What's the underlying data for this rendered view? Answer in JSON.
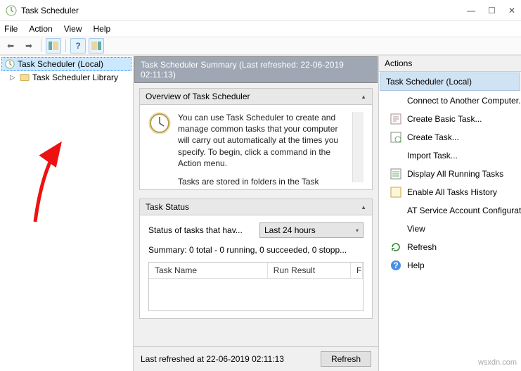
{
  "window": {
    "title": "Task Scheduler",
    "controls": {
      "min": "—",
      "max": "☐",
      "close": "✕"
    }
  },
  "menu": {
    "file": "File",
    "action": "Action",
    "view": "View",
    "help": "Help"
  },
  "tree": {
    "root": "Task Scheduler (Local)",
    "child": "Task Scheduler Library"
  },
  "summary": {
    "header": "Task Scheduler Summary (Last refreshed: 22-06-2019 02:11:13)",
    "overview_title": "Overview of Task Scheduler",
    "overview_text1": "You can use Task Scheduler to create and manage common tasks that your computer will carry out automatically at the times you specify. To begin, click a command in the Action menu.",
    "overview_text2": "Tasks are stored in folders in the Task",
    "status_title": "Task Status",
    "status_label": "Status of tasks that hav...",
    "status_period": "Last 24 hours",
    "status_summary": "Summary: 0 total - 0 running, 0 succeeded, 0 stopp...",
    "cols": {
      "name": "Task Name",
      "result": "Run Result",
      "r3": "F"
    },
    "footer_text": "Last refreshed at 22-06-2019 02:11:13",
    "refresh_btn": "Refresh"
  },
  "actions": {
    "title": "Actions",
    "header": "Task Scheduler (Local)",
    "items": [
      "Connect to Another Computer...",
      "Create Basic Task...",
      "Create Task...",
      "Import Task...",
      "Display All Running Tasks",
      "Enable All Tasks History",
      "AT Service Account Configuration",
      "View",
      "Refresh",
      "Help"
    ]
  },
  "watermark": "wsxdn.com"
}
